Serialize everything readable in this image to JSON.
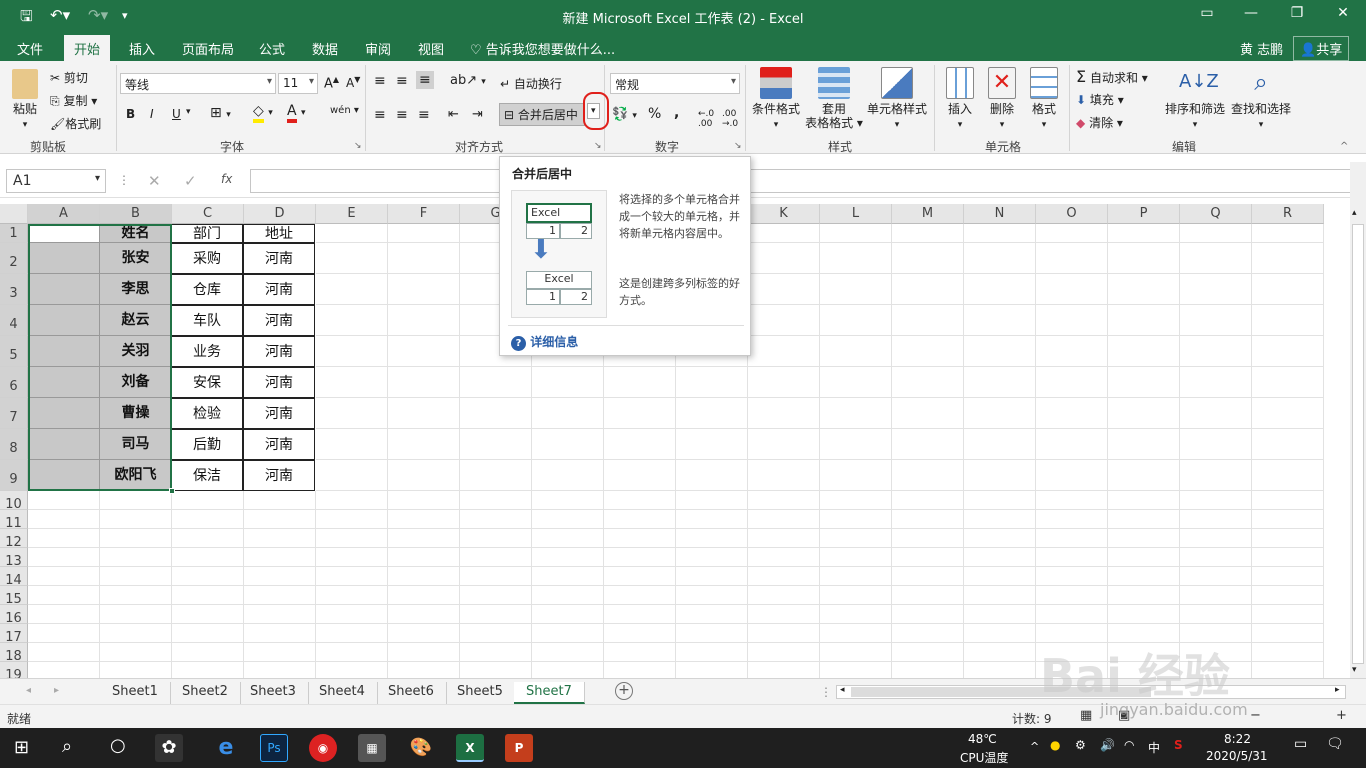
{
  "window": {
    "title": "新建 Microsoft Excel 工作表 (2) - Excel"
  },
  "tabs": [
    {
      "label": "文件"
    },
    {
      "label": "开始"
    },
    {
      "label": "插入"
    },
    {
      "label": "页面布局"
    },
    {
      "label": "公式"
    },
    {
      "label": "数据"
    },
    {
      "label": "审阅"
    },
    {
      "label": "视图"
    }
  ],
  "tellme": "告诉我您想要做什么...",
  "user": "黄 志鹏",
  "share": "共享",
  "clipboard": {
    "paste": "粘贴",
    "cut": "剪切",
    "copy": "复制",
    "painter": "格式刷",
    "group": "剪贴板"
  },
  "font": {
    "name": "等线",
    "size": "11",
    "bold": "B",
    "italic": "I",
    "underline": "U",
    "phonetic": "wén",
    "group": "字体"
  },
  "align": {
    "wrap": "自动换行",
    "merge": "合并后居中",
    "group": "对齐方式"
  },
  "number": {
    "format": "常规",
    "percent": "%",
    "comma": ",",
    "group": "数字"
  },
  "styles": {
    "cond": "条件格式",
    "table_l1": "套用",
    "table_l2": "表格格式",
    "cell": "单元格样式",
    "group": "样式"
  },
  "cells": {
    "insert": "插入",
    "delete": "删除",
    "format": "格式",
    "group": "单元格"
  },
  "editing": {
    "autosum": "自动求和",
    "fill": "填充",
    "clear": "清除",
    "sort": "排序和筛选",
    "find": "查找和选择",
    "group": "编辑"
  },
  "formula": {
    "namebox": "A1",
    "fx": "fx",
    "value": ""
  },
  "columns": [
    "A",
    "B",
    "C",
    "D",
    "E",
    "F",
    "G",
    "H",
    "I",
    "J",
    "K",
    "L",
    "M",
    "N",
    "O",
    "P",
    "Q",
    "R"
  ],
  "rows": [
    "1",
    "2",
    "3",
    "4",
    "5",
    "6",
    "7",
    "8",
    "9",
    "10",
    "11",
    "12",
    "13",
    "14",
    "15",
    "16",
    "17",
    "18",
    "19"
  ],
  "table": [
    [
      "",
      "姓名",
      "部门",
      "地址"
    ],
    [
      "",
      "张安",
      "采购",
      "河南"
    ],
    [
      "",
      "李思",
      "仓库",
      "河南"
    ],
    [
      "",
      "赵云",
      "车队",
      "河南"
    ],
    [
      "",
      "关羽",
      "业务",
      "河南"
    ],
    [
      "",
      "刘备",
      "安保",
      "河南"
    ],
    [
      "",
      "曹操",
      "检验",
      "河南"
    ],
    [
      "",
      "司马",
      "后勤",
      "河南"
    ],
    [
      "",
      "欧阳飞",
      "保洁",
      "河南"
    ]
  ],
  "tooltip": {
    "title": "合并后居中",
    "desc1": "将选择的多个单元格合并成一个较大的单元格，并将新单元格内容居中。",
    "desc2": "这是创建跨多列标签的好方式。",
    "more": "详细信息",
    "demo_word": "Excel",
    "demo_v1": "1",
    "demo_v2": "2"
  },
  "sheets": [
    "Sheet1",
    "Sheet2",
    "Sheet3",
    "Sheet4",
    "Sheet6",
    "Sheet5",
    "Sheet7"
  ],
  "active_sheet": "Sheet7",
  "status": {
    "ready": "就绪",
    "count": "计数: 9"
  },
  "taskbar": {
    "temp": "48℃",
    "cpu": "CPU温度",
    "ime": "中",
    "time": "8:22",
    "date": "2020/5/31"
  },
  "watermark": {
    "text": "Bai 经验",
    "url": "jingyan.baidu.com"
  },
  "colors": {
    "excel_green": "#217346",
    "highlight_red": "#e0201b"
  }
}
